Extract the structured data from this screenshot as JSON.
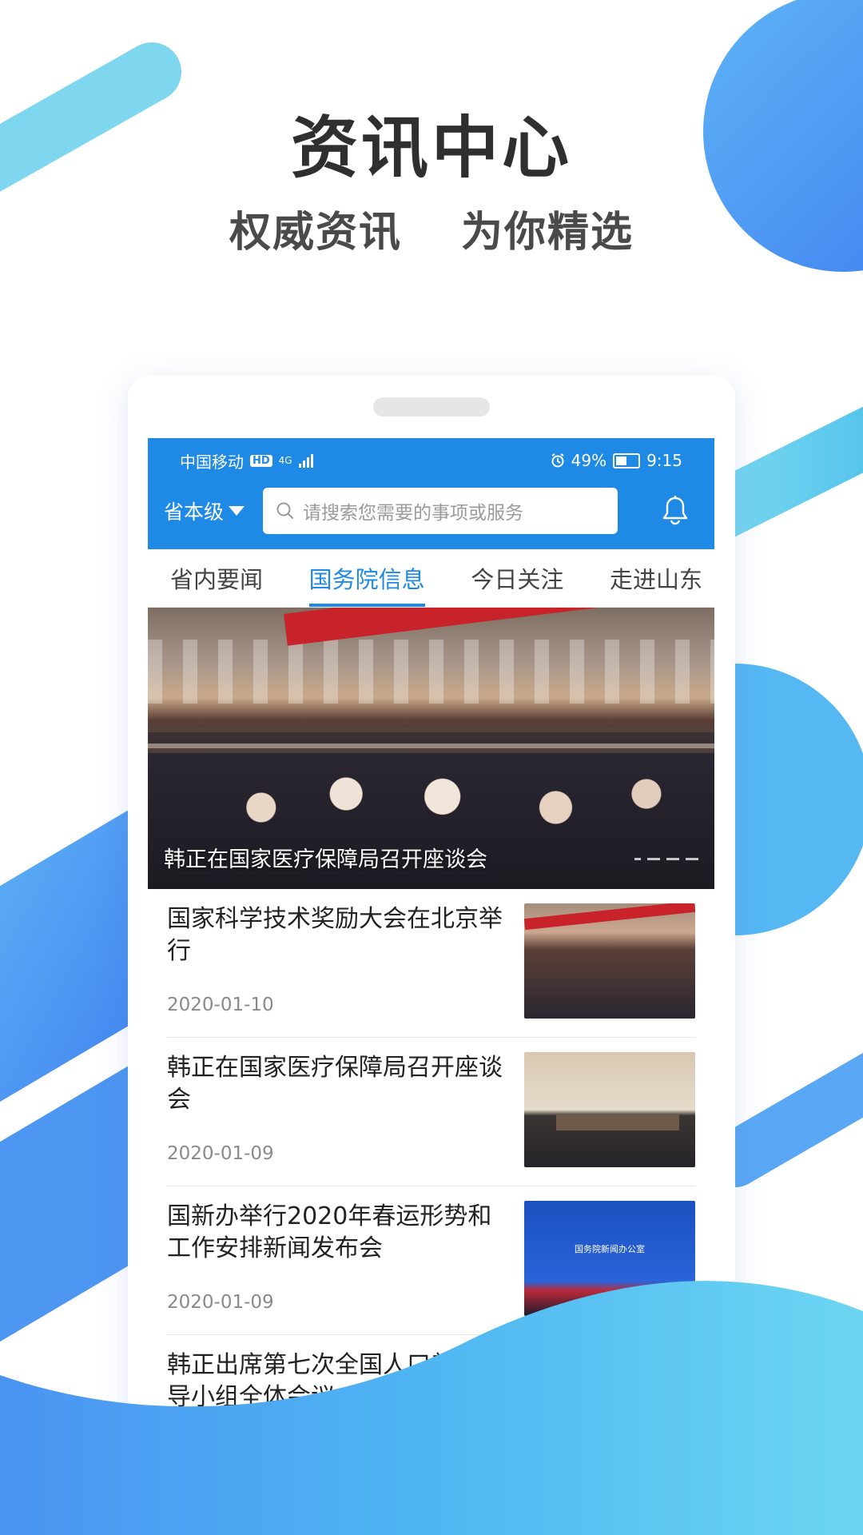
{
  "hero": {
    "title": "资讯中心",
    "subtitle_left": "权威资讯",
    "subtitle_right": "为你精选"
  },
  "status_bar": {
    "carrier": "中国移动",
    "hd_badge": "HD",
    "network": "4G",
    "battery": "49%",
    "battery_level": 0.49,
    "time": "9:15"
  },
  "app_bar": {
    "region_label": "省本级",
    "search_placeholder": "请搜索您需要的事项或服务"
  },
  "tabs": [
    {
      "label": "省内要闻",
      "active": false
    },
    {
      "label": "国务院信息",
      "active": true
    },
    {
      "label": "今日关注",
      "active": false
    },
    {
      "label": "走进山东",
      "active": false
    }
  ],
  "banner": {
    "caption": "韩正在国家医疗保障局召开座谈会"
  },
  "news": [
    {
      "title": "国家科学技术奖励大会在北京举行",
      "date": "2020-01-10"
    },
    {
      "title": "韩正在国家医疗保障局召开座谈会",
      "date": "2020-01-09"
    },
    {
      "title": "国新办举行2020年春运形势和工作安排新闻发布会",
      "date": "2020-01-09",
      "thumb_text": "国务院新闻办公室"
    },
    {
      "title": "韩正出席第七次全国人口普查领导小组全体会议",
      "date": ""
    }
  ],
  "colors": {
    "primary": "#1f8ae6",
    "accent_light": "#6fd3f0",
    "accent_blue": "#4b8ff0"
  },
  "icons": [
    "search-icon",
    "bell-icon",
    "dropdown-triangle-icon",
    "alarm-icon",
    "battery-icon",
    "signal-icon"
  ]
}
